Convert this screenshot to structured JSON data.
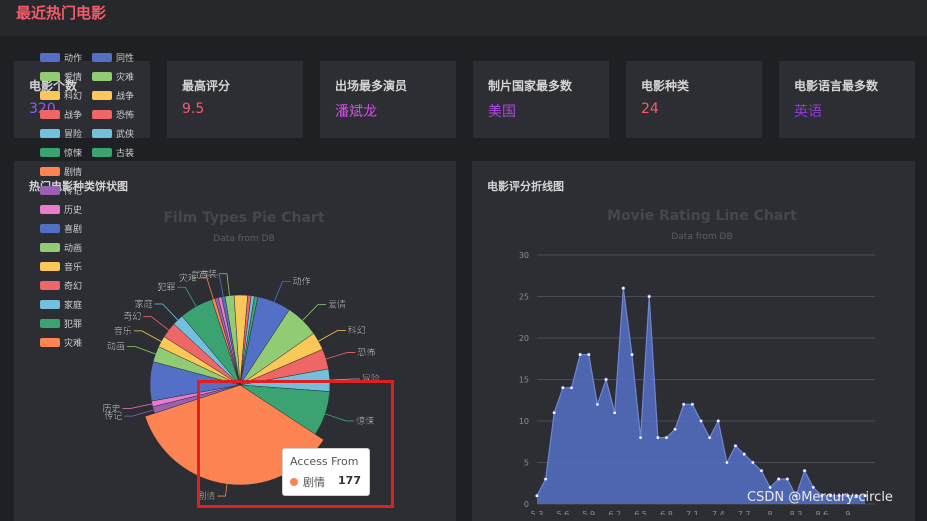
{
  "app": {
    "title": "最近热门电影"
  },
  "stats": [
    {
      "label": "电影个数",
      "value": "320",
      "color": "#8e5cf6"
    },
    {
      "label": "最高评分",
      "value": "9.5",
      "color": "#f25c6b"
    },
    {
      "label": "出场最多演员",
      "value": "潘斌龙",
      "color": "#cf53e6"
    },
    {
      "label": "制片国家最多数",
      "value": "美国",
      "color": "#b048e6"
    },
    {
      "label": "电影种类",
      "value": "24",
      "color": "#f25c6b"
    },
    {
      "label": "电影语言最多数",
      "value": "英语",
      "color": "#8e3bd6"
    }
  ],
  "pie_panel": {
    "title": "热门电影种类饼状图",
    "chart_title": "Film Types Pie Chart",
    "chart_subtitle": "Data from DB",
    "legend_left": [
      "动作",
      "爱情",
      "科幻",
      "冒险",
      "剧情",
      "传记",
      "历史",
      "喜剧",
      "动画",
      "音乐",
      "奇幻",
      "家庭",
      "犯罪",
      "灾难"
    ],
    "legend_left_visible": [
      "动作",
      "爱情",
      "科幻",
      "战争",
      "冒险",
      "惊悚",
      "剧情",
      "传记",
      "历史",
      "喜剧",
      "动画",
      "音乐",
      "奇幻",
      "家庭",
      "犯罪",
      "灾难"
    ],
    "legend_right_visible": [
      "同性",
      "灾难",
      "战争",
      "恐怖",
      "武侠",
      "古装"
    ],
    "tooltip": {
      "title": "Access From",
      "name": "剧情",
      "value": "177"
    }
  },
  "line_panel": {
    "title": "电影评分折线图",
    "chart_title": "Movie Rating Line Chart",
    "chart_subtitle": "Data from DB"
  },
  "watermark": "CSDN @Mercury-circle",
  "colors": {
    "palette": [
      "#5470c6",
      "#91cc75",
      "#fac858",
      "#ee6666",
      "#73c0de",
      "#3ba272",
      "#fc8452",
      "#9a60b4",
      "#ea7ccc"
    ],
    "highlight": "#e02020"
  },
  "chart_data": [
    {
      "type": "pie",
      "title": "Film Types Pie Chart",
      "subtitle": "Data from DB",
      "categories": [
        "剧情",
        "悬疑",
        "惊悚",
        "冒险",
        "恐怖",
        "科幻",
        "喜剧",
        "爱情",
        "动作",
        "古装",
        "武侠",
        "战争",
        "灾难",
        "同性",
        "犯罪",
        "家庭",
        "奇幻",
        "音乐",
        "动画",
        "传记",
        "历史",
        "运动",
        "西部",
        "儿童"
      ],
      "values": [
        177,
        12,
        40,
        20,
        18,
        16,
        35,
        30,
        30,
        8,
        3,
        3,
        3,
        3,
        30,
        10,
        14,
        10,
        14,
        6,
        5,
        3,
        3,
        3
      ],
      "visible_labels": [
        "动作",
        "爱情",
        "科幻",
        "恐怖",
        "冒险",
        "惊悚",
        "剧情",
        "传记",
        "历史",
        "犯罪",
        "家庭",
        "奇幻",
        "音乐",
        "动画",
        "古装",
        "武侠",
        "灾难"
      ]
    },
    {
      "type": "area",
      "title": "Movie Rating Line Chart",
      "subtitle": "Data from DB",
      "ylim": [
        0,
        30
      ],
      "yticks": [
        0,
        5,
        10,
        15,
        20,
        25,
        30
      ],
      "x": [
        5.3,
        5.4,
        5.5,
        5.6,
        5.7,
        5.8,
        5.9,
        6.0,
        6.1,
        6.2,
        6.3,
        6.4,
        6.5,
        6.6,
        6.7,
        6.8,
        6.9,
        7.0,
        7.1,
        7.2,
        7.3,
        7.4,
        7.5,
        7.6,
        7.7,
        7.8,
        7.9,
        8.0,
        8.1,
        8.2,
        8.3,
        8.4,
        8.5,
        8.6,
        8.7,
        8.8,
        8.9,
        9.0,
        9.1
      ],
      "xtick_labels": [
        "5.3",
        "5.6",
        "5.9",
        "6.2",
        "6.5",
        "6.8",
        "7.1",
        "7.4",
        "7.7",
        "8",
        "8.3",
        "8.6",
        "9"
      ],
      "values": [
        1,
        3,
        11,
        14,
        14,
        18,
        18,
        12,
        15,
        11,
        26,
        18,
        8,
        25,
        8,
        8,
        9,
        12,
        12,
        10,
        8,
        10,
        5,
        7,
        6,
        5,
        4,
        2,
        3,
        3,
        1,
        4,
        2,
        1,
        1,
        1,
        1,
        1,
        1
      ]
    }
  ]
}
